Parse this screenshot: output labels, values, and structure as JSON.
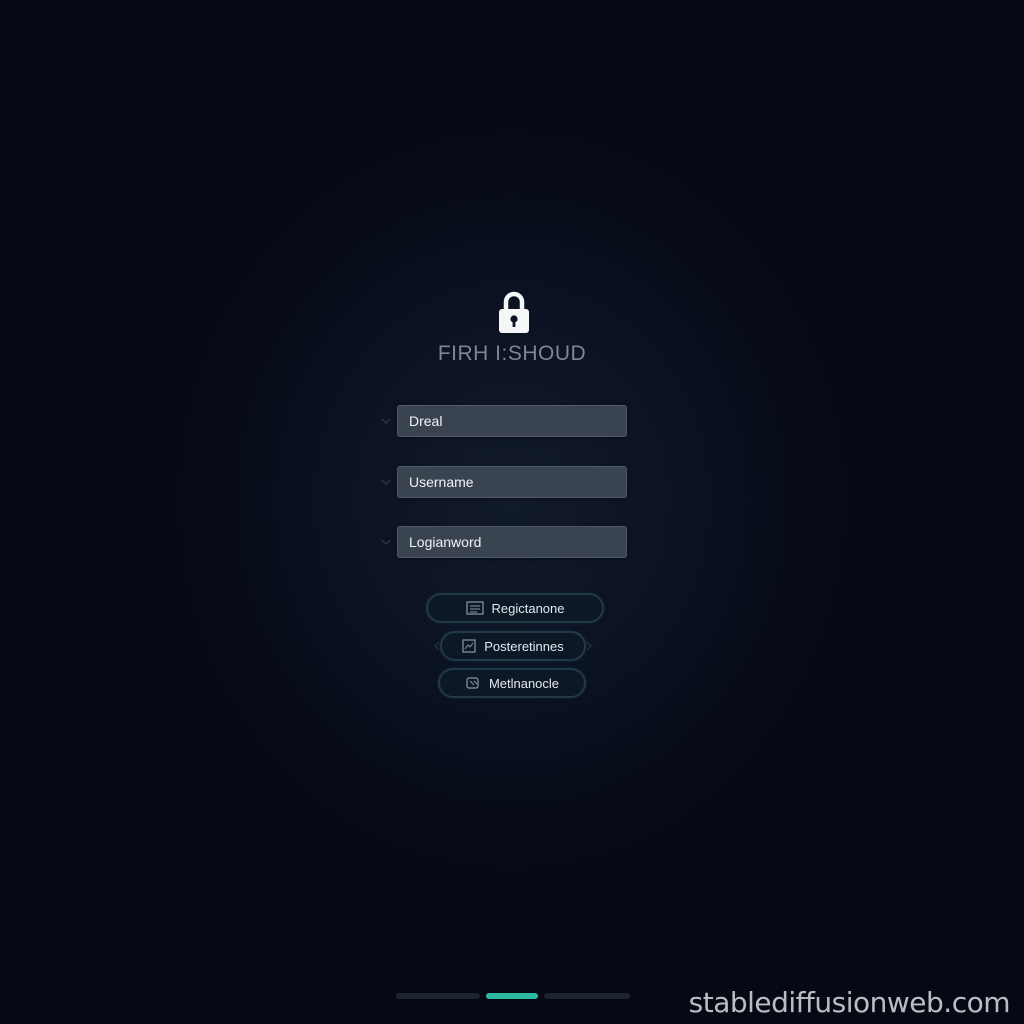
{
  "app": {
    "title": "FIRH I:SHOUD"
  },
  "icons": {
    "lock": "lock-icon",
    "chevron": "chevron-icon",
    "registration": "list-icon",
    "preferences": "image-icon",
    "method": "card-icon"
  },
  "form": {
    "fields": [
      {
        "value": "Dreal"
      },
      {
        "value": "Username"
      },
      {
        "value": "Logianword"
      }
    ]
  },
  "buttons": [
    {
      "label": "Regictanone"
    },
    {
      "label": "Posteretinnes"
    },
    {
      "label": "Metlnanocle"
    }
  ],
  "pager": {
    "pages": 3,
    "active_index": 1
  },
  "watermark": "stablediffusionweb.com",
  "colors": {
    "background": "#070c18",
    "field": "#3a4350",
    "accent": "#2fb8a0",
    "button_border": "#22394a"
  }
}
